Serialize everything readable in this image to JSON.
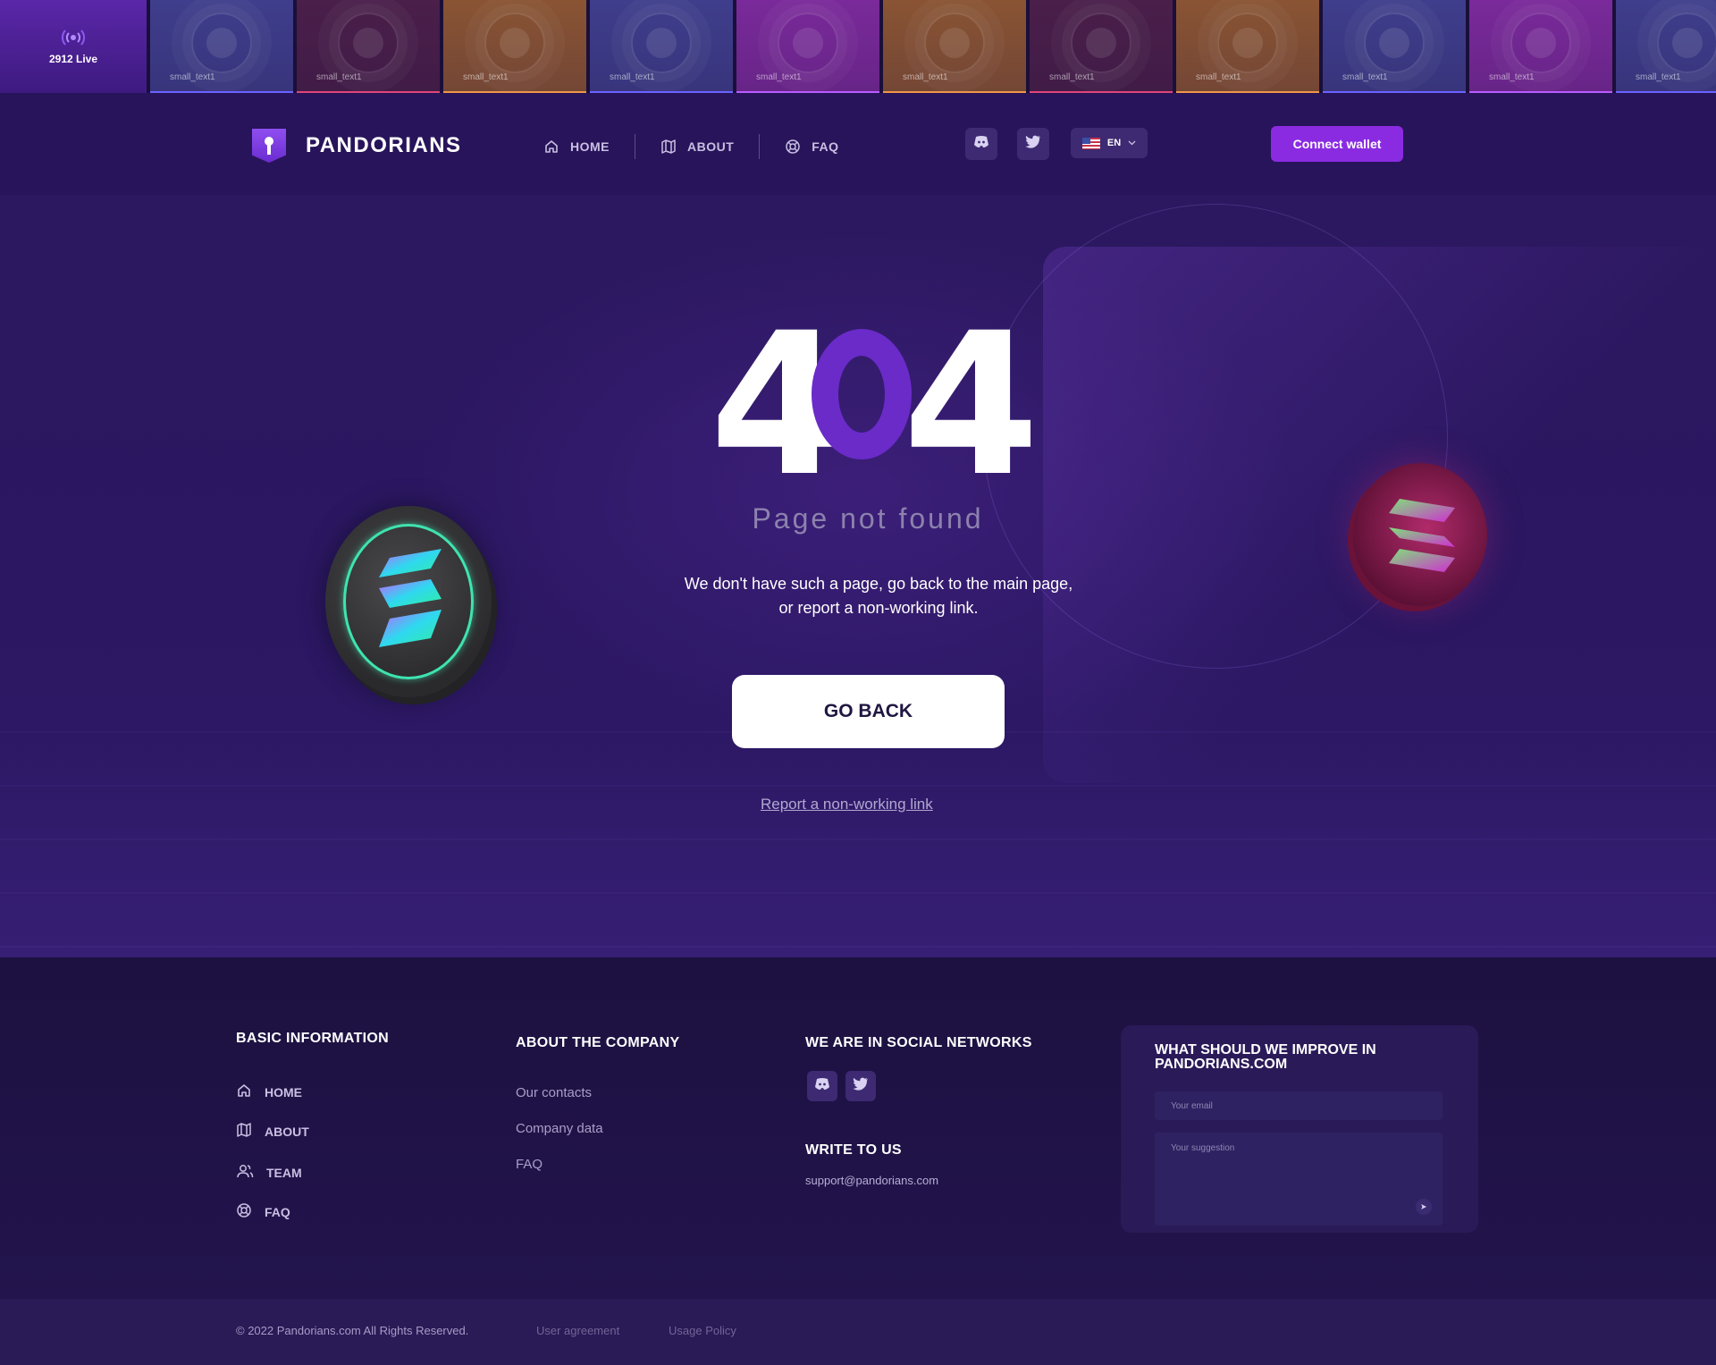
{
  "ticker": {
    "live_label": "2912 Live",
    "tiles": [
      {
        "label": "small_text1",
        "bg": "#3f3e8c",
        "bar": "#6a63ff"
      },
      {
        "label": "small_text1",
        "bg": "#4a1f4a",
        "bar": "#e0457b"
      },
      {
        "label": "small_text1",
        "bg": "#8a5434",
        "bar": "#f0954a"
      },
      {
        "label": "small_text1",
        "bg": "#3f3e8c",
        "bar": "#6a63ff"
      },
      {
        "label": "small_text1",
        "bg": "#7a2a9a",
        "bar": "#b95cff"
      },
      {
        "label": "small_text1",
        "bg": "#8a5434",
        "bar": "#f0954a"
      },
      {
        "label": "small_text1",
        "bg": "#4a1f4a",
        "bar": "#e0457b"
      },
      {
        "label": "small_text1",
        "bg": "#8a5434",
        "bar": "#f0954a"
      },
      {
        "label": "small_text1",
        "bg": "#3f3e8c",
        "bar": "#6a63ff"
      },
      {
        "label": "small_text1",
        "bg": "#7a2a9a",
        "bar": "#b95cff"
      },
      {
        "label": "small_text1",
        "bg": "#3f3e8c",
        "bar": "#6a63ff"
      }
    ]
  },
  "header": {
    "brand": "PANDORIANS",
    "nav": [
      {
        "label": "HOME",
        "icon": "home-icon"
      },
      {
        "label": "ABOUT",
        "icon": "map-icon"
      },
      {
        "label": "FAQ",
        "icon": "lifebuoy-icon"
      }
    ],
    "language": "EN",
    "connect_label": "Connect wallet"
  },
  "hero": {
    "digit1": "4",
    "digit3": "4",
    "subtitle": "Page not found",
    "description": "We don't have such a page, go back to the main page, or report a non-working link.",
    "go_back_label": "GO BACK",
    "report_label": "Report a non-working link"
  },
  "footer": {
    "basic": {
      "title": "BASIC INFORMATION",
      "links": [
        {
          "label": "HOME",
          "icon": "home-icon"
        },
        {
          "label": "ABOUT",
          "icon": "map-icon"
        },
        {
          "label": "TEAM",
          "icon": "users-icon"
        },
        {
          "label": "FAQ",
          "icon": "lifebuoy-icon"
        }
      ]
    },
    "company": {
      "title": "ABOUT THE COMPANY",
      "links": [
        "Our contacts",
        "Company data",
        "FAQ"
      ]
    },
    "social": {
      "title": "WE ARE IN SOCIAL NETWORKS",
      "write_title": "WRITE TO US",
      "email": "support@pandorians.com"
    },
    "feedback": {
      "title": "WHAT SHOULD WE IMPROVE IN PANDORIANS.COM",
      "email_placeholder": "Your email",
      "suggestion_placeholder": "Your suggestion"
    },
    "bottom": {
      "copyright": "© 2022 Pandorians.com All Rights Reserved.",
      "user_agreement": "User agreement",
      "usage_policy": "Usage Policy"
    }
  },
  "colors": {
    "accent": "#8a2be2",
    "background": "#2a1758",
    "zero_ring": "#6a2bc9"
  }
}
